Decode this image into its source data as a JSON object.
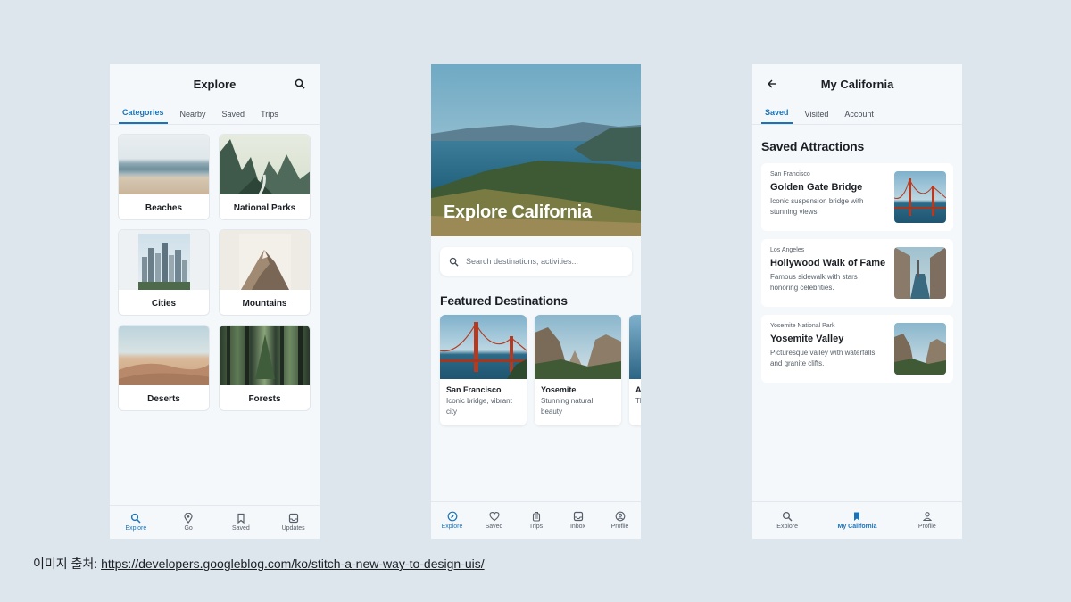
{
  "explore": {
    "title": "Explore",
    "tabs": [
      "Categories",
      "Nearby",
      "Saved",
      "Trips"
    ],
    "categories": [
      "Beaches",
      "National Parks",
      "Cities",
      "Mountains",
      "Deserts",
      "Forests"
    ],
    "nav": [
      "Explore",
      "Go",
      "Saved",
      "Updates"
    ]
  },
  "california": {
    "hero_title": "Explore California",
    "search_placeholder": "Search destinations, activities...",
    "featured_title": "Featured Destinations",
    "featured": [
      {
        "name": "San Francisco",
        "desc": "Iconic bridge, vibrant city"
      },
      {
        "name": "Yosemite",
        "desc": "Stunning natural beauty"
      },
      {
        "name": "A",
        "desc": "Th ac"
      }
    ],
    "nav": [
      "Explore",
      "Saved",
      "Trips",
      "Inbox",
      "Profile"
    ]
  },
  "mycal": {
    "title": "My California",
    "tabs": [
      "Saved",
      "Visited",
      "Account"
    ],
    "section_title": "Saved Attractions",
    "attractions": [
      {
        "location": "San Francisco",
        "name": "Golden Gate Bridge",
        "desc": "Iconic suspension bridge with stunning views."
      },
      {
        "location": "Los Angeles",
        "name": "Hollywood Walk of Fame",
        "desc": "Famous sidewalk with stars honoring celebrities."
      },
      {
        "location": "Yosemite National Park",
        "name": "Yosemite Valley",
        "desc": "Picturesque valley with waterfalls and granite cliffs."
      }
    ],
    "nav": [
      "Explore",
      "My California",
      "Profile"
    ]
  },
  "caption": {
    "prefix": "이미지 출처: ",
    "link": "https://developers.googleblog.com/ko/stitch-a-new-way-to-design-uis/"
  },
  "colors": {
    "accent": "#1a73b8",
    "background": "#dde6ec",
    "phone_bg": "#f5f8fb"
  }
}
